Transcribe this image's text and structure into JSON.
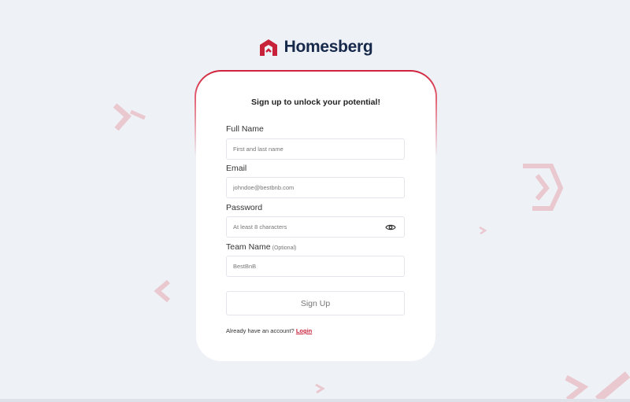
{
  "brand": {
    "name": "Homesberg",
    "logo_icon": "house-chevron-logo-icon",
    "logo_color": "#c8213a",
    "text_color": "#17294a"
  },
  "form": {
    "heading": "Sign up to unlock your potential!",
    "full_name": {
      "label": "Full Name",
      "placeholder": "First and last name",
      "value": ""
    },
    "email": {
      "label": "Email",
      "placeholder": "johndoe@bestbnb.com",
      "value": ""
    },
    "password": {
      "label": "Password",
      "placeholder": "At least 8 characters",
      "value": "",
      "toggle_icon": "eye-icon"
    },
    "team_name": {
      "label": "Team Name",
      "optional_note": "(Optional)",
      "placeholder": "BestBnB",
      "value": ""
    },
    "submit_label": "Sign Up",
    "login_prompt": "Already have an account?",
    "login_link": "Login"
  },
  "colors": {
    "accent": "#c8213a",
    "background": "#eef1f6",
    "card": "#ffffff"
  }
}
